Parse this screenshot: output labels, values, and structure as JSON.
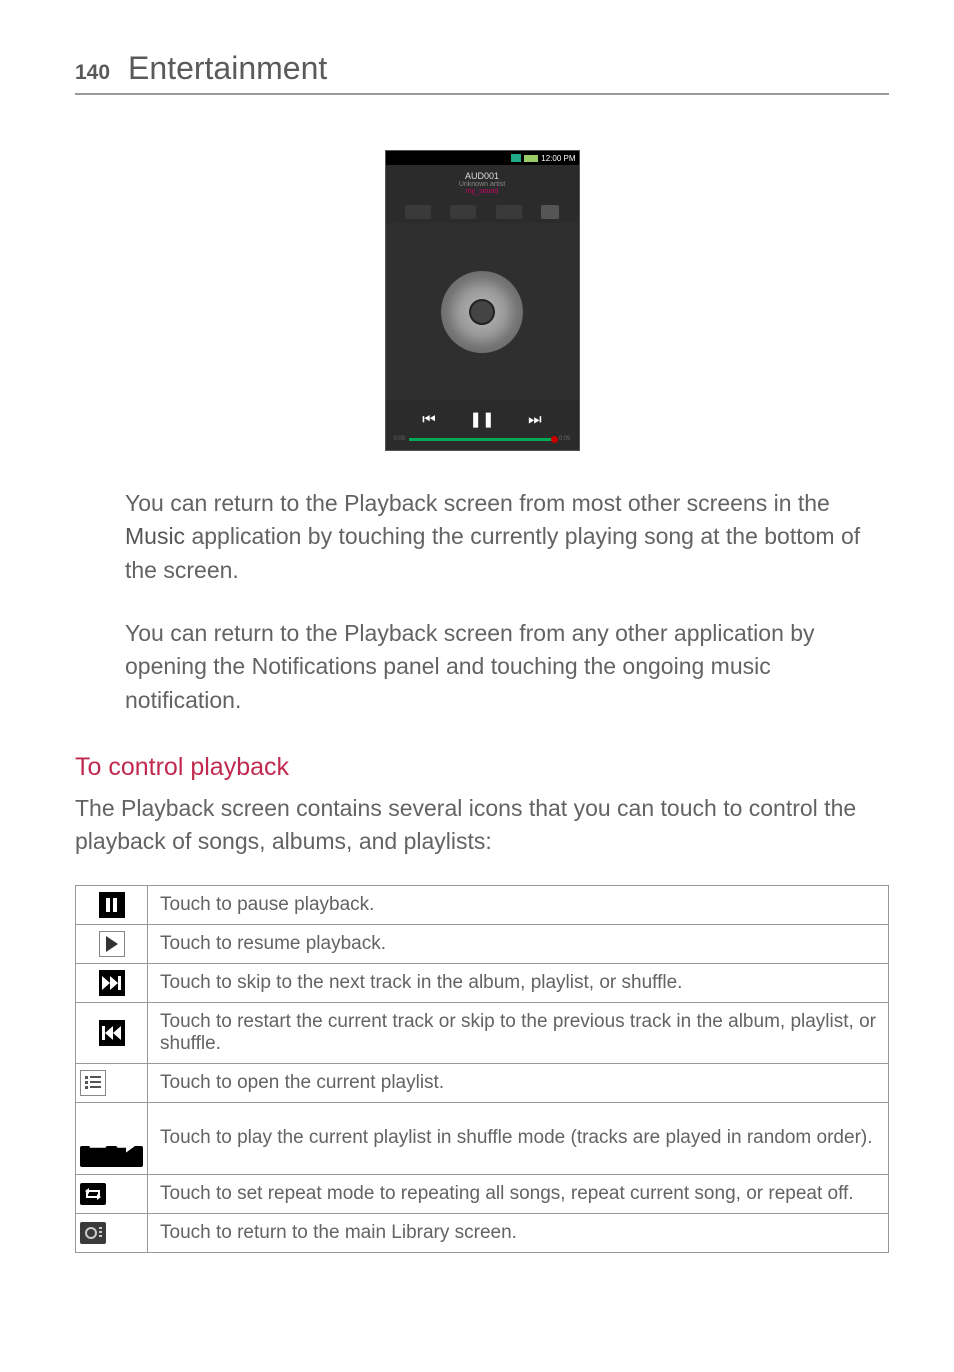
{
  "header": {
    "page_number": "140",
    "chapter": "Entertainment"
  },
  "phone": {
    "time": "12:00 PM",
    "track_title": "AUD001",
    "artist": "Unknown artist",
    "album": "my_sound",
    "elapsed": "0:00",
    "remaining": "0:05"
  },
  "paragraphs": {
    "p1_a": "You can return to the Playback screen from most other screens in the ",
    "p1_bold": "Music",
    "p1_b": " application by touching the currently playing song at the bottom of the screen.",
    "p2": "You can return to the Playback screen from any other application by opening the Notifications panel and touching the ongoing music notification."
  },
  "section": {
    "heading": "To control playback",
    "intro": "The Playback screen contains several icons that you can touch to control the playback of songs, albums, and playlists:"
  },
  "icons": {
    "pause": "pause-icon",
    "play": "play-icon",
    "next": "next-track-icon",
    "prev": "previous-track-icon",
    "playlist": "playlist-icon",
    "shuffle": "shuffle-icon",
    "repeat": "repeat-icon",
    "library": "library-icon"
  },
  "table": {
    "pause": "Touch to pause playback.",
    "play": "Touch to resume playback.",
    "next": "Touch to skip to the next track in the album, playlist, or shuffle.",
    "prev": "Touch to restart the current track or skip to the previous track in the album, playlist, or shuffle.",
    "playlist": "Touch to open the current playlist.",
    "shuffle": "Touch to play the current playlist in shuffle mode (tracks are played in random order).",
    "repeat": "Touch to set repeat mode to repeating all songs, repeat current song, or repeat off.",
    "library": "Touch to return to the main Library screen."
  }
}
